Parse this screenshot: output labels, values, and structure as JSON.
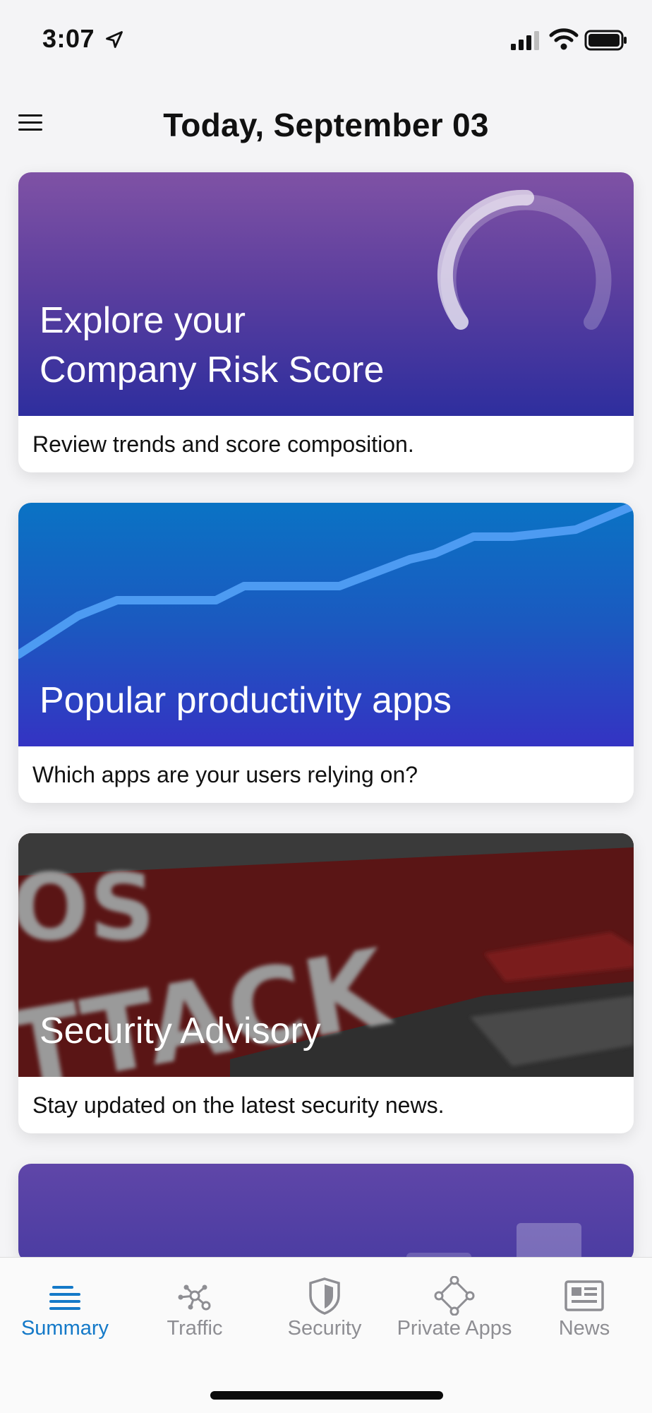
{
  "status": {
    "time": "3:07"
  },
  "header": {
    "title": "Today, September 03"
  },
  "cards": [
    {
      "title_lines": [
        "Explore your",
        "Company Risk Score"
      ],
      "description": "Review trends and score composition."
    },
    {
      "title_lines": [
        "Popular productivity apps"
      ],
      "description": "Which apps are your users relying on?"
    },
    {
      "title_lines": [
        "Security Advisory"
      ],
      "description": "Stay updated on the latest security news."
    }
  ],
  "tabs": [
    {
      "label": "Summary",
      "icon": "summary-icon",
      "active": true
    },
    {
      "label": "Traffic",
      "icon": "traffic-icon",
      "active": false
    },
    {
      "label": "Security",
      "icon": "shield-icon",
      "active": false
    },
    {
      "label": "Private Apps",
      "icon": "private-apps-icon",
      "active": false
    },
    {
      "label": "News",
      "icon": "newspaper-icon",
      "active": false
    }
  ],
  "colors": {
    "accent": "#1479c8",
    "inactive": "#8e8e93"
  }
}
